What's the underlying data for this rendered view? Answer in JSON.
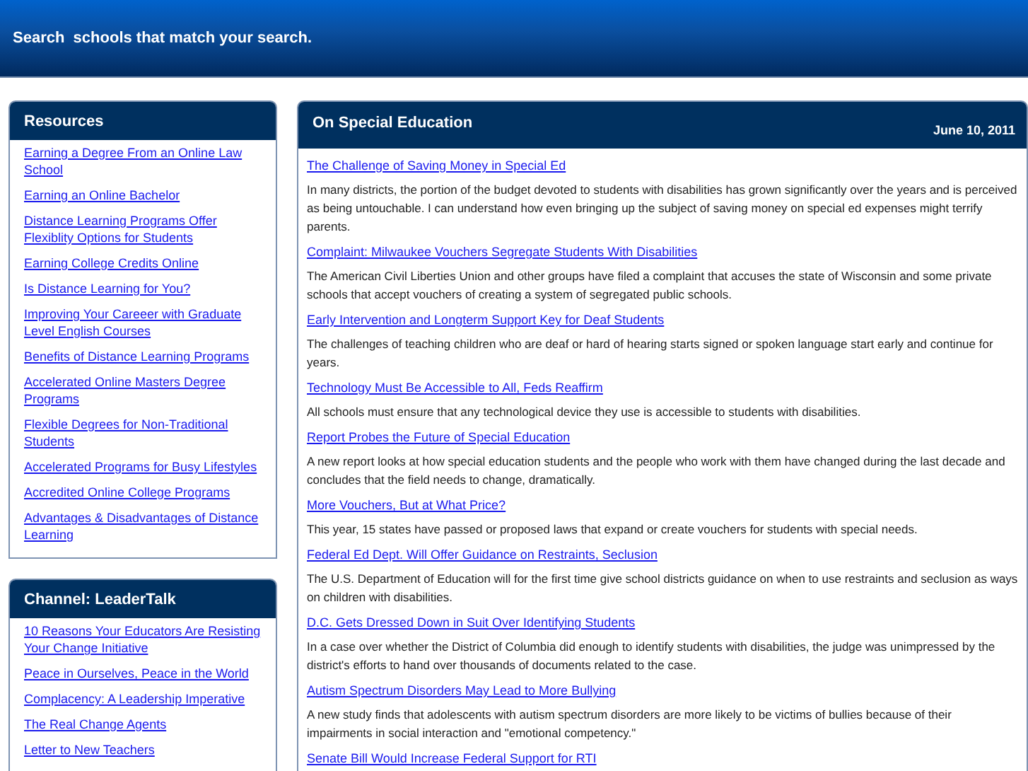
{
  "header": {
    "tagline": "Search  schools that match your search."
  },
  "sidebar": [
    {
      "title": "Resources",
      "links": [
        "Earning a Degree From an Online Law School",
        "Earning an Online Bachelor",
        "Distance Learning Programs Offer Flexiblity Options for Students",
        "Earning College Credits Online",
        "Is Distance Learning for You?",
        "Improving Your Careeer with Graduate Level English Courses",
        "Benefits of Distance Learning Programs",
        "Accelerated Online Masters Degree Programs",
        "Flexible Degrees for Non-Traditional Students",
        "Accelerated Programs for Busy Lifestyles",
        "Accredited Online College Programs",
        "Advantages & Disadvantages of Distance Learning"
      ]
    },
    {
      "title": "Channel: LeaderTalk",
      "links": [
        "10 Reasons Your Educators Are Resisting Your Change Initiative",
        "Peace in Ourselves, Peace in the World",
        "Complacency: A Leadership Imperative",
        "The Real Change Agents",
        "Letter to New Teachers"
      ]
    }
  ],
  "main": {
    "title": "On Special Education",
    "date": "June 10, 2011",
    "articles": [
      {
        "title": "The Challenge of Saving Money in Special Ed",
        "summary": "In many districts, the portion of the budget devoted to students with disabilities has grown significantly over the years and is perceived as being untouchable. I can understand how even bringing up the subject of saving money on special ed expenses might terrify parents."
      },
      {
        "title": "Complaint: Milwaukee Vouchers Segregate Students With Disabilities",
        "summary": "The American Civil Liberties Union and other groups have filed a complaint that accuses the state of Wisconsin and some private schools that accept vouchers of creating a system of segregated public schools."
      },
      {
        "title": "Early Intervention and Longterm Support Key for Deaf Students",
        "summary": "The challenges of teaching children who are deaf or hard of hearing starts signed or spoken language start early and continue for years."
      },
      {
        "title": "Technology Must Be Accessible to All, Feds Reaffirm",
        "summary": "All schools must ensure that any technological device they use is accessible to students with disabilities."
      },
      {
        "title": "Report Probes the Future of Special Education",
        "summary": "A new report looks at how special education students and the people who work with them have changed during the last decade and concludes that the field needs to change, dramatically."
      },
      {
        "title": "More Vouchers, But at What Price?",
        "summary": "This year, 15 states have passed or proposed laws that expand or create vouchers for students with special needs."
      },
      {
        "title": "Federal Ed Dept. Will Offer Guidance on Restraints, Seclusion",
        "summary": "The U.S. Department of Education will for the first time give school districts guidance on when to use restraints and seclusion as ways on children with disabilities."
      },
      {
        "title": "D.C. Gets Dressed Down in Suit Over Identifying Students",
        "summary": "In a case over whether the District of Columbia did enough to identify students with disabilities, the judge was unimpressed by the district's efforts to hand over thousands of documents related to the case."
      },
      {
        "title": "Autism Spectrum Disorders May Lead to More Bullying",
        "summary": "A new study finds that adolescents with autism spectrum disorders are more likely to be victims of bullies because of their impairments in social interaction and \"emotional competency.\""
      },
      {
        "title": "Senate Bill Would Increase Federal Support for RTI"
      }
    ]
  }
}
